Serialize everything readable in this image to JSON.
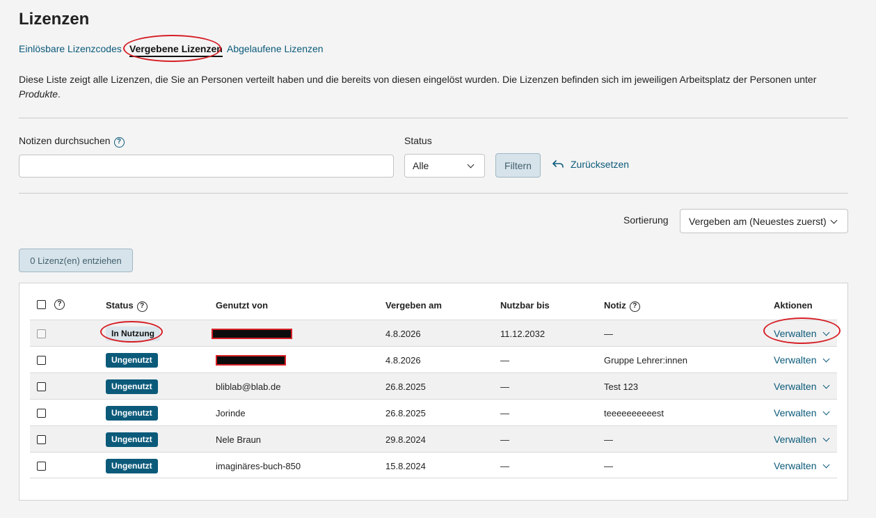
{
  "page": {
    "title": "Lizenzen"
  },
  "tabs": [
    {
      "label": "Einlösbare Lizenzcodes",
      "active": false
    },
    {
      "label": "Vergebene Lizenzen",
      "active": true
    },
    {
      "label": "Abgelaufene Lizenzen",
      "active": false
    }
  ],
  "description": {
    "text": "Diese Liste zeigt alle Lizenzen, die Sie an Personen verteilt haben und die bereits von diesen eingelöst wurden. Die Lizenzen befinden sich im jeweiligen Arbeitsplatz der Personen unter",
    "emphasis": "Produkte",
    "suffix": "."
  },
  "filters": {
    "search_label": "Notizen durchsuchen",
    "search_value": "",
    "status_label": "Status",
    "status_selected": "Alle",
    "filter_button": "Filtern",
    "reset_link": "Zurücksetzen"
  },
  "sorting": {
    "label": "Sortierung",
    "selected": "Vergeben am (Neuestes zuerst)"
  },
  "revoke_button": "0 Lizenz(en) entziehen",
  "table": {
    "headers": {
      "status": "Status",
      "used_by": "Genutzt von",
      "assigned_on": "Vergeben am",
      "usable_until": "Nutzbar bis",
      "note": "Notiz",
      "actions": "Aktionen"
    },
    "rows": [
      {
        "status": "In Nutzung",
        "used_by": "",
        "assigned_on": "4.8.2026",
        "usable_until": "11.12.2032",
        "note": "—",
        "action": "Verwalten"
      },
      {
        "status": "Ungenutzt",
        "used_by": "",
        "assigned_on": "4.8.2026",
        "usable_until": "—",
        "note": "Gruppe Lehrer:innen",
        "action": "Verwalten"
      },
      {
        "status": "Ungenutzt",
        "used_by": "bliblab@blab.de",
        "assigned_on": "26.8.2025",
        "usable_until": "—",
        "note": "Test 123",
        "action": "Verwalten"
      },
      {
        "status": "Ungenutzt",
        "used_by": "Jorinde",
        "assigned_on": "26.8.2025",
        "usable_until": "—",
        "note": "teeeeeeeeeest",
        "action": "Verwalten"
      },
      {
        "status": "Ungenutzt",
        "used_by": "Nele Braun",
        "assigned_on": "29.8.2024",
        "usable_until": "—",
        "note": "—",
        "action": "Verwalten"
      },
      {
        "status": "Ungenutzt",
        "used_by": "imaginäres-buch-850",
        "assigned_on": "15.8.2024",
        "usable_until": "—",
        "note": "—",
        "action": "Verwalten"
      }
    ]
  },
  "icons": {
    "help": "question-circle-icon",
    "reset": "arrow-back-icon",
    "dropdown": "chevron-down-icon"
  },
  "colors": {
    "link": "#0b5a7a",
    "badge_unused": "#0b5a7a",
    "badge_in_use": "#dbe6ec",
    "annotation": "#d61f26"
  }
}
